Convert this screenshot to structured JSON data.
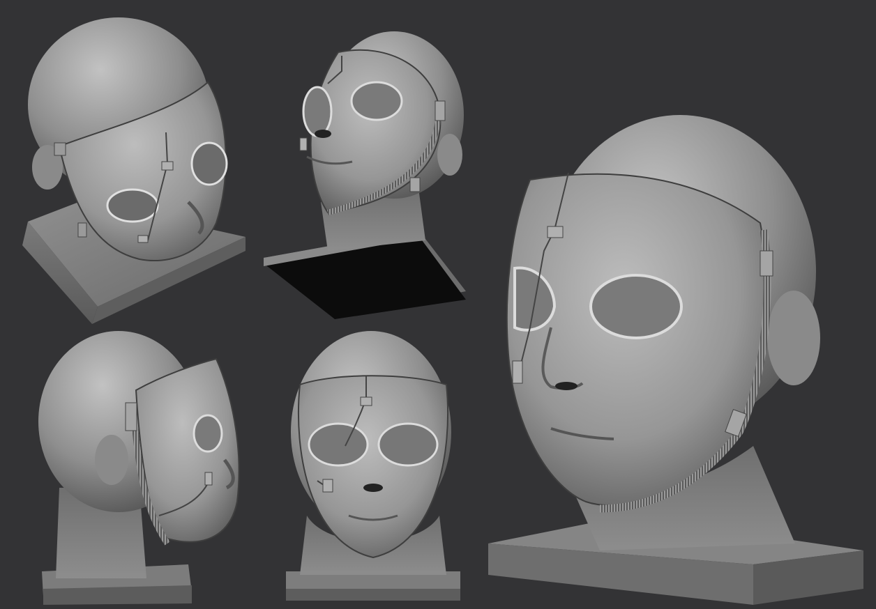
{
  "scene": {
    "background": "#333335",
    "clay_light": "#b3b3b3",
    "clay_mid": "#8a8a8a",
    "clay_dark": "#4a4a4a",
    "base_bottom": "#0d0d0d"
  },
  "views": [
    {
      "id": "top-three-quarter"
    },
    {
      "id": "low-angle"
    },
    {
      "id": "back-three-quarter"
    },
    {
      "id": "front"
    },
    {
      "id": "three-quarter-closeup"
    }
  ]
}
